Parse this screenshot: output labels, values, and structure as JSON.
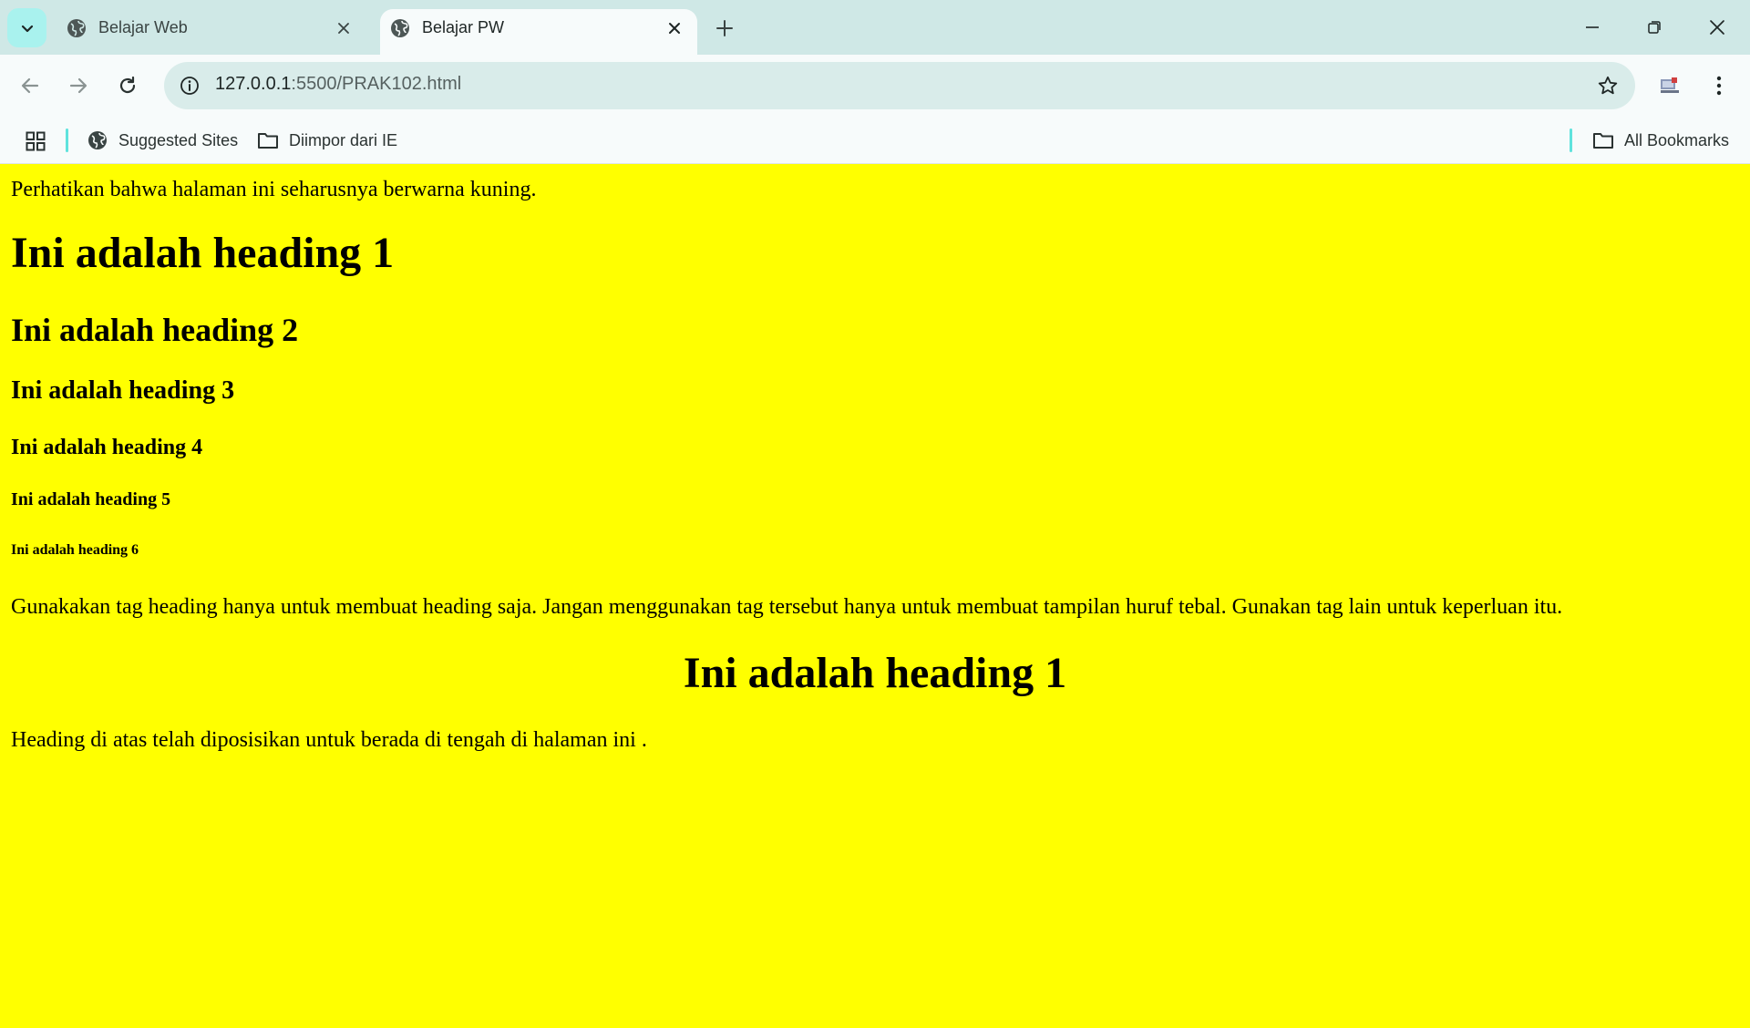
{
  "browser": {
    "tabs": [
      {
        "title": "Belajar Web",
        "active": false
      },
      {
        "title": "Belajar PW",
        "active": true
      }
    ],
    "address": {
      "host": "127.0.0.1",
      "rest": ":5500/PRAK102.html"
    },
    "bookmarks": {
      "suggested": "Suggested Sites",
      "imported": "Diimpor dari IE",
      "all": "All Bookmarks"
    },
    "icons": {
      "tab_list": "chevron-down-icon",
      "favicon": "globe-icon",
      "tab_close": "close-icon",
      "new_tab": "plus-icon",
      "minimize": "minimize-icon",
      "restore": "restore-icon",
      "close_window": "close-icon",
      "back": "arrow-left-icon",
      "forward": "arrow-right-icon",
      "reload": "reload-icon",
      "site_info": "info-icon",
      "bookmark_star": "star-icon",
      "extension": "extension-icon",
      "menu": "kebab-menu-icon",
      "apps": "apps-grid-icon",
      "folder": "folder-icon"
    },
    "colors": {
      "tabbar": "#cfe8e6",
      "toolbar": "#f7fbfb",
      "omnibox": "#d9ecea",
      "accent": "#5fe3dd"
    }
  },
  "page": {
    "background": "#ffff00",
    "intro": "Perhatikan bahwa halaman ini seharusnya berwarna kuning.",
    "h1": "Ini adalah heading 1",
    "h2": "Ini adalah heading 2",
    "h3": "Ini adalah heading 3",
    "h4": "Ini adalah heading 4",
    "h5": "Ini adalah heading 5",
    "h6": "Ini adalah heading 6",
    "usage_note": "Gunakakan tag heading hanya untuk membuat heading saja. Jangan menggunakan tag tersebut hanya untuk membuat tampilan huruf tebal. Gunakan tag lain untuk keperluan itu.",
    "h1_centered": "Ini adalah heading 1",
    "center_note": "Heading di atas telah diposisikan untuk berada di tengah di halaman ini ."
  }
}
